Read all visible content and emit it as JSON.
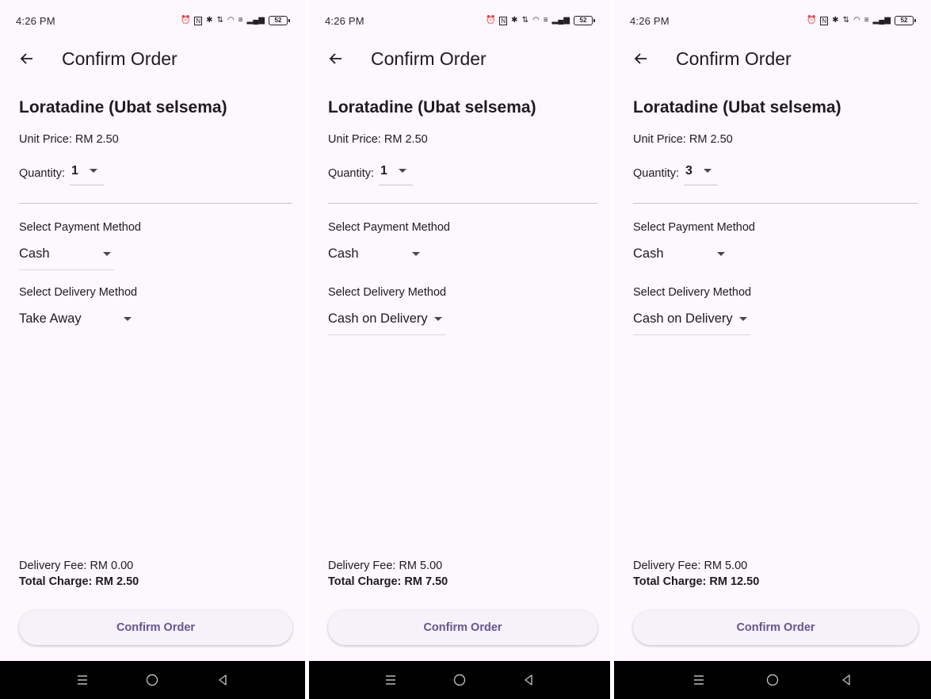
{
  "screens": [
    {
      "status": {
        "time": "4:26 PM",
        "battery": "52"
      },
      "app_bar": {
        "title": "Confirm Order"
      },
      "product": {
        "name": "Loratadine (Ubat selsema)",
        "unit_price": "Unit Price: RM 2.50"
      },
      "quantity": {
        "label": "Quantity:",
        "value": "1"
      },
      "payment": {
        "label": "Select Payment Method",
        "value": "Cash"
      },
      "delivery": {
        "label": "Select Delivery Method",
        "value": "Take Away"
      },
      "summary": {
        "delivery_fee": "Delivery Fee: RM 0.00",
        "total_charge": "Total Charge: RM 2.50"
      },
      "confirm_button": "Confirm Order"
    },
    {
      "status": {
        "time": "4:26 PM",
        "battery": "52"
      },
      "app_bar": {
        "title": "Confirm Order"
      },
      "product": {
        "name": "Loratadine (Ubat selsema)",
        "unit_price": "Unit Price: RM 2.50"
      },
      "quantity": {
        "label": "Quantity:",
        "value": "1"
      },
      "payment": {
        "label": "Select Payment Method",
        "value": "Cash"
      },
      "delivery": {
        "label": "Select Delivery Method",
        "value": "Cash on Delivery"
      },
      "summary": {
        "delivery_fee": "Delivery Fee: RM 5.00",
        "total_charge": "Total Charge: RM 7.50"
      },
      "confirm_button": "Confirm Order"
    },
    {
      "status": {
        "time": "4:26 PM",
        "battery": "52"
      },
      "app_bar": {
        "title": "Confirm Order"
      },
      "product": {
        "name": "Loratadine (Ubat selsema)",
        "unit_price": "Unit Price: RM 2.50"
      },
      "quantity": {
        "label": "Quantity:",
        "value": "3"
      },
      "payment": {
        "label": "Select Payment Method",
        "value": "Cash"
      },
      "delivery": {
        "label": "Select Delivery Method",
        "value": "Cash on Delivery"
      },
      "summary": {
        "delivery_fee": "Delivery Fee: RM 5.00",
        "total_charge": "Total Charge: RM 12.50"
      },
      "confirm_button": "Confirm Order"
    }
  ],
  "theme": {
    "background": "#fdf7fe",
    "primary_text": "#1d1b20",
    "button_bg": "#f7f2fa",
    "button_text": "#65558f",
    "nav_bar": "#000000"
  },
  "icons": {
    "back": "arrow-left-icon",
    "nav_menu": "menu-icon",
    "nav_home": "home-circle-icon",
    "nav_back": "back-triangle-icon"
  }
}
